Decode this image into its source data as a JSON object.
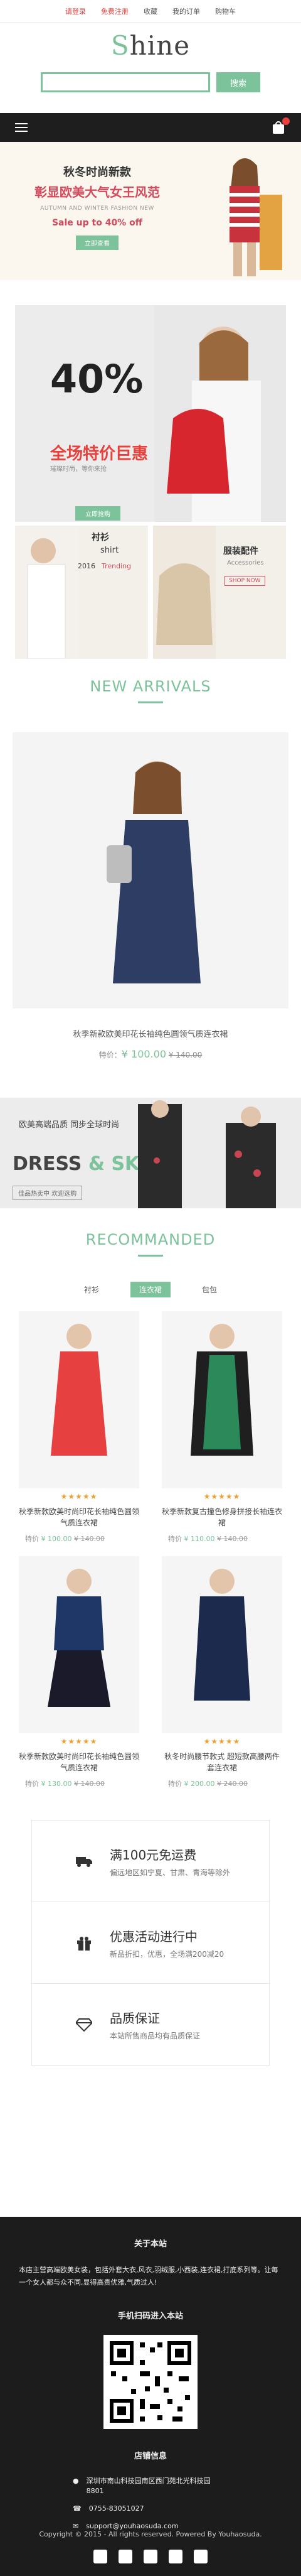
{
  "topbar": {
    "login": "请登录",
    "register": "免费注册",
    "favorites": "收藏",
    "my_orders": "我的订单",
    "cart": "购物车"
  },
  "logo": {
    "s_letter": "S",
    "rest": "hine"
  },
  "search": {
    "placeholder": "",
    "button": "搜索"
  },
  "hero1": {
    "title": "秋冬时尚新款",
    "subtitle": "彰显欧美大气女王风范",
    "en": "AUTUMN AND WINTER FASHION NEW",
    "sale": "Sale up to 40% off",
    "button": "立即查看"
  },
  "promo": {
    "big": "40% OFF",
    "sale": "全场特价巨惠",
    "sub": "璀璨时尚，等你来抢",
    "button": "立即抢购"
  },
  "tiles": {
    "shirt_cn": "衬衫",
    "shirt_en": "shirt",
    "shirt_year": "2016",
    "shirt_trend": "Trending",
    "acc_cn": "服装配件",
    "acc_en": "Accessories",
    "acc_btn": "SHOP NOW"
  },
  "new_arrivals": {
    "title": "NEW ARRIVALS",
    "name": "秋季新款欧美印花长袖纯色圆领气质连衣裙",
    "price_label": "特价：",
    "price": "¥ 100.00",
    "old_price": "¥ 140.00"
  },
  "banner2": {
    "line1": "欧美高端品质 同步全球时尚",
    "dress": "DRESS",
    "amp": " & ",
    "skirt": "SKIRT",
    "btn": "佳品热卖中 欢迎选购"
  },
  "recommanded": {
    "title": "RECOMMANDED",
    "tabs": [
      "衬衫",
      "连衣裙",
      "包包"
    ],
    "active_tab": "连衣裙"
  },
  "products": [
    {
      "name": "秋季新款欧美时尚印花长袖纯色圆领气质连衣裙",
      "price_label": "特价",
      "price": "¥ 100.00",
      "old": "¥ 140.00",
      "stars": "★★★★★"
    },
    {
      "name": "秋季新款复古撞色修身拼接长袖连衣裙",
      "price_label": "特价",
      "price": "¥ 110.00",
      "old": "¥ 140.00",
      "stars": "★★★★★"
    },
    {
      "name": "秋季新款欧美时尚印花长袖纯色圆领气质连衣裙",
      "price_label": "特价",
      "price": "¥ 130.00",
      "old": "¥ 140.00",
      "stars": "★★★★★"
    },
    {
      "name": "秋冬时尚腰节款式 超短款高腰两件套连衣裙",
      "price_label": "特价",
      "price": "¥ 200.00",
      "old": "¥ 240.00",
      "stars": "★★★★★"
    }
  ],
  "features": [
    {
      "title": "满100元免运费",
      "sub": "偏远地区如宁夏、甘肃、青海等除外"
    },
    {
      "title": "优惠活动进行中",
      "sub": "新品折扣，优惠，全场满200减20"
    },
    {
      "title": "品质保证",
      "sub": "本站所售商品均有品质保证"
    }
  ],
  "footer": {
    "about_title": "关于本站",
    "about_text": "本店主营高端欧美女装，包括外套大衣,风衣,羽绒服,小西装,连衣裙,打底系列等。让每一个女人都与众不同,显得高贵优雅,气质过人!",
    "qr_title": "手机扫码进入本站",
    "store_title": "店铺信息",
    "address": "深圳市南山科技园南区西门苑北光科技园8801",
    "phone": "0755-83051027",
    "email": "support@youhaosuda.com",
    "copyright": "Copyright © 2015 - All rights reserved.  Powered By Youhaosuda."
  }
}
